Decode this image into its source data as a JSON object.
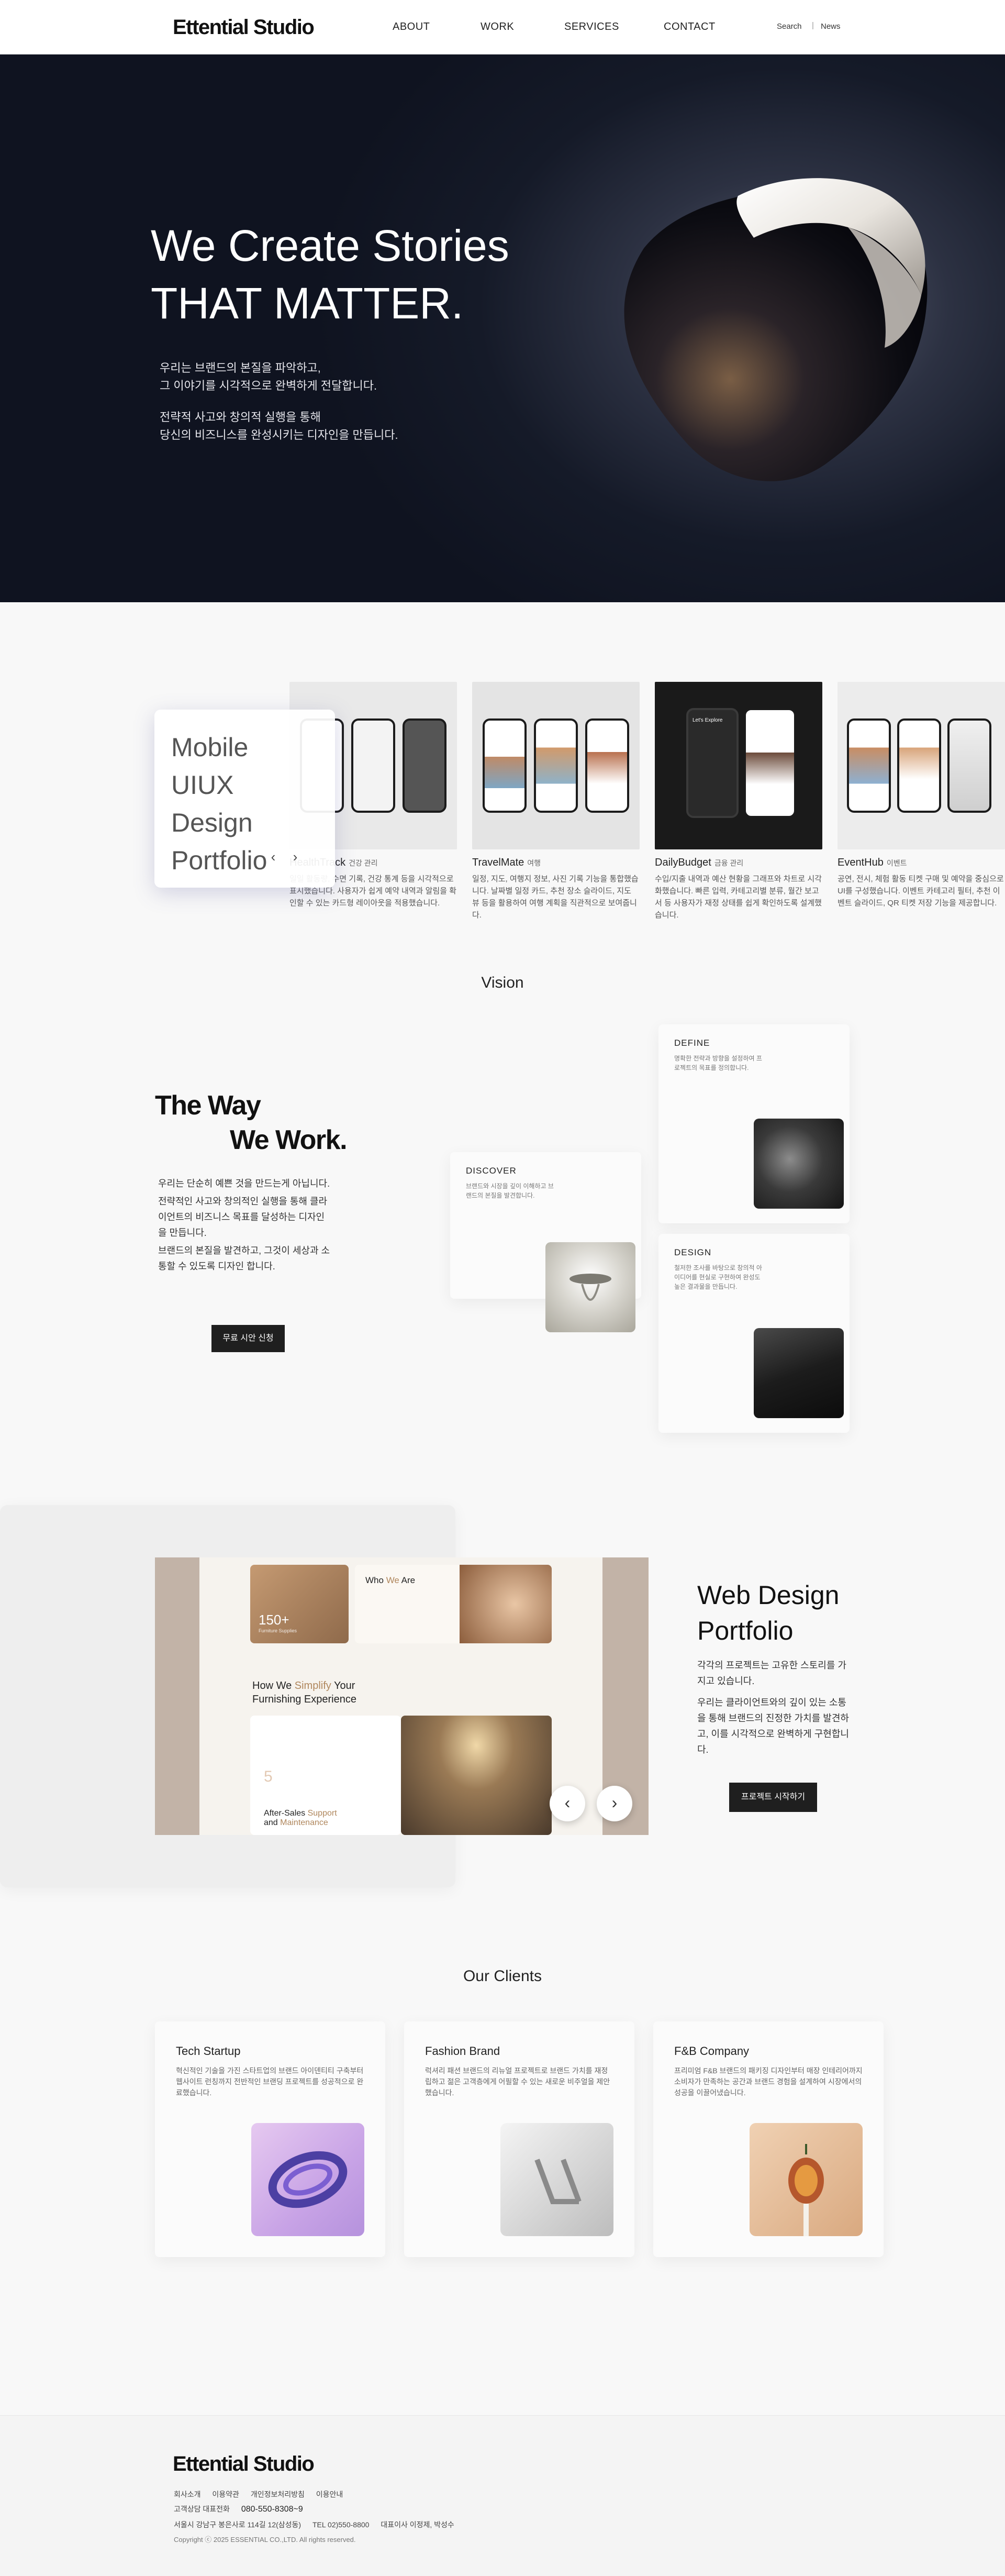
{
  "header": {
    "logo": "Ettential Studio",
    "nav": [
      "ABOUT",
      "WORK",
      "SERVICES",
      "CONTACT"
    ],
    "search": "Search",
    "separator": "|",
    "news": "News"
  },
  "hero": {
    "title_line1": "We Create Stories",
    "title_line2": "THAT MATTER.",
    "desc1_line1": "우리는 브랜드의 본질을 파악하고,",
    "desc1_line2": "그 이야기를 시각적으로 완벽하게 전달합니다.",
    "desc2_line1": "전략적 사고와 창의적 실행을 통해",
    "desc2_line2": "당신의 비즈니스를 완성시키는 디자인을 만듭니다."
  },
  "mobile_portfolio": {
    "floating_line1": "Mobile",
    "floating_line2": "UIUX Design",
    "floating_line3": "Portfolio",
    "prev": "‹",
    "next": "›",
    "cards": [
      {
        "title": "HealthTrack",
        "tag": "건강 관리",
        "desc": "일일 활동량, 수면 기록, 건강 통계 등을 시각적으로 표시했습니다. 사용자가 쉽게 예약 내역과 알림을 확인할 수 있는 카드형 레이아웃을 적용했습니다."
      },
      {
        "title": "TravelMate",
        "tag": "여행",
        "desc": "일정, 지도, 여행지 정보, 사진 기록 기능을 통합했습니다. 날짜별 일정 카드, 추천 장소 슬라이드, 지도 뷰 등을 활용하여 여행 계획을 직관적으로 보여줍니다."
      },
      {
        "title": "DailyBudget",
        "tag": "금융 관리",
        "desc": "수입/지출 내역과 예산 현황을 그래프와 차트로 시각화했습니다. 빠른 입력, 카테고리별 분류, 월간 보고서 등 사용자가 재정 상태를 쉽게 확인하도록 설계했습니다."
      },
      {
        "title": "EventHub",
        "tag": "이벤트",
        "desc": "공연, 전시, 체험 활동 티켓 구매 및 예약을 중심으로 UI를 구성했습니다. 이벤트 카테고리 필터, 추천 이벤트 슬라이드, QR 티켓 저장 기능을 제공합니다."
      }
    ],
    "daily_screen": "Let's Explore"
  },
  "vision": {
    "label": "Vision",
    "title_line1": "The Way",
    "title_line2": "We Work.",
    "desc": [
      "우리는 단순히 예쁜 것을 만드는게 아닙니다.",
      "전략적인 사고와 창의적인 실행을 통해 클라이언트의 비즈니스 목표를 달성하는 디자인을 만듭니다.",
      "브랜드의 본질을 발견하고, 그것이 세상과 소통할 수 있도록 디자인 합니다."
    ],
    "cta": "무료 시안 신청",
    "steps": {
      "discover": {
        "title": "DISCOVER",
        "desc": "브랜드와 시장을 깊이 이해하고 브랜드의 본질을 발견합니다."
      },
      "define": {
        "title": "DEFINE",
        "desc": "명확한 전략과 방향을 설정하여 프로젝트의 목표를 정의합니다."
      },
      "design": {
        "title": "DESIGN",
        "desc": "철저한 조사를 바탕으로 창의적 아이디어를 현실로 구현하여 완성도 높은 결과물을 만듭니다."
      }
    }
  },
  "web_design": {
    "title_line1": "Web Design",
    "title_line2": "Portfolio",
    "desc1": "각각의 프로젝트는 고유한 스토리를 가지고 있습니다.",
    "desc2": "우리는 클라이언트와의 깊이 있는 소통을 통해 브랜드의 진정한 가치를 발견하고, 이를 시각적으로 완벽하게 구현합니다.",
    "cta": "프로젝트 시작하기",
    "shot": {
      "stat": "150+",
      "stat_label": "Furniture Supplies",
      "who_prefix": "Who ",
      "who_highlight": "We",
      "who_suffix": " Are",
      "how_prefix": "How We ",
      "how_highlight": "Simplify",
      "how_suffix": " Your",
      "how_line2": "Furnishing Experience",
      "num": "5",
      "after_prefix": "After-Sales ",
      "after_highlight": "Support",
      "after_line2_prefix": "and ",
      "after_line2_highlight": "Maintenance"
    },
    "prev": "‹",
    "next": "›"
  },
  "clients": {
    "label": "Our Clients",
    "items": [
      {
        "title": "Tech Startup",
        "desc": "혁신적인 기술을 가진 스타트업의 브랜드 아이덴티티 구축부터 웹사이트 런칭까지 전반적인 브랜딩 프로젝트를 성공적으로 완료했습니다."
      },
      {
        "title": "Fashion Brand",
        "desc": "럭셔리 패션 브랜드의 리뉴얼 프로젝트로 브랜드 가치를 재정립하고 젊은 고객층에게 어필할 수 있는 새로운 비주얼을 제안했습니다."
      },
      {
        "title": "F&B Company",
        "desc": "프리미엄 F&B 브랜드의 패키징 디자인부터 매장 인테리어까지 소비자가 만족하는 공간과 브랜드 경험을 설계하여 시장에서의 성공을 이끌어냈습니다."
      }
    ]
  },
  "footer": {
    "logo": "Ettential Studio",
    "links": [
      "회사소개",
      "이용약관",
      "개인정보처리방침",
      "이용안내"
    ],
    "rep_label": "고객상담 대표전화",
    "rep_phone": "080-550-8308~9",
    "address": "서울시 강남구 봉은사로 114길 12(삼성동)",
    "tel": "TEL 02)550-8800",
    "ceo": "대표이사 이정제, 박성수",
    "copyright": "Copyright ⓒ 2025 ESSENTIAL CO.,LTD. All rights reserved."
  },
  "colors": {
    "accent": "#b0875d",
    "dark": "#1f1f1f",
    "hero_bg": "#151a28"
  },
  "icons": [
    "chevron-left-icon",
    "chevron-right-icon"
  ]
}
